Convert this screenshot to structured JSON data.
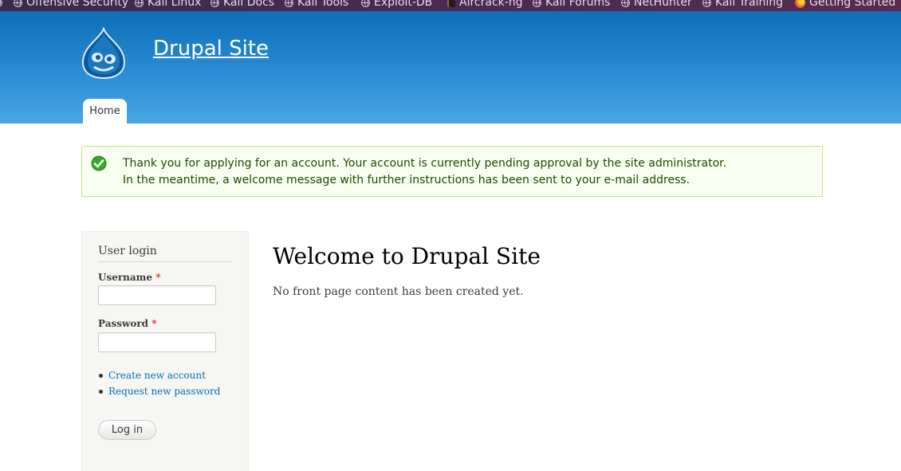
{
  "bookmarks": [
    {
      "label": "Offensive Security",
      "icon": "globe-icon"
    },
    {
      "label": "Kali Linux",
      "icon": "globe-icon"
    },
    {
      "label": "Kali Docs",
      "icon": "globe-icon"
    },
    {
      "label": "Kali Tools",
      "icon": "globe-icon"
    },
    {
      "label": "Exploit-DB",
      "icon": "globe-icon"
    },
    {
      "label": "Aircrack-ng",
      "icon": "aircrack-icon"
    },
    {
      "label": "Kali Forums",
      "icon": "globe-icon"
    },
    {
      "label": "NetHunter",
      "icon": "globe-icon"
    },
    {
      "label": "Kali Training",
      "icon": "globe-icon"
    },
    {
      "label": "Getting Started",
      "icon": "firefox-icon"
    }
  ],
  "header": {
    "site_name": "Drupal Site",
    "logo_icon": "drupal-drop-icon"
  },
  "nav": {
    "tabs": [
      {
        "label": "Home",
        "active": true
      }
    ]
  },
  "status": {
    "icon": "check-icon",
    "line1": "Thank you for applying for an account. Your account is currently pending approval by the site administrator.",
    "line2": "In the meantime, a welcome message with further instructions has been sent to your e-mail address."
  },
  "login_block": {
    "title": "User login",
    "username_label": "Username",
    "password_label": "Password",
    "required_marker": "*",
    "username_value": "",
    "password_value": "",
    "links": [
      "Create new account",
      "Request new password"
    ],
    "submit_label": "Log in"
  },
  "main": {
    "title": "Welcome to Drupal Site",
    "body": "No front page content has been created yet."
  },
  "colors": {
    "header_top": "#0d6fb8",
    "header_bottom": "#4aa6e4",
    "link": "#0071b3",
    "status_bg": "#f8fff0",
    "status_border": "#bbee77",
    "status_text": "#234600",
    "required": "#e4312d"
  }
}
